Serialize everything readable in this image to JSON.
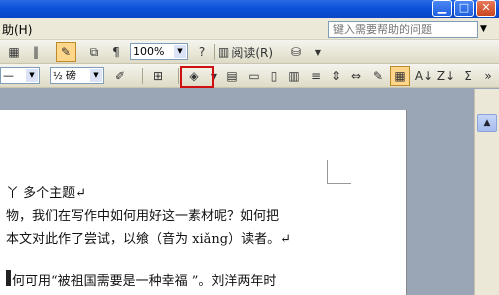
{
  "menubar": {
    "help_item": "助(H)",
    "help_search_placeholder": "键入需要帮助的问题"
  },
  "toolbar1": {
    "zoom_value": "100%",
    "read_label": "阅读(R)"
  },
  "toolbar2": {
    "font_size_value": "½ 磅",
    "line_dash": "—"
  },
  "document": {
    "line1": "丫 多个主题↵",
    "line2": "物，我们在写作中如何用好这一素材呢？如何把",
    "line3": "本文对此作了尝试，以飨（音为 xiǎng）读者。↵",
    "line4": "何可用“被祖国需要是一种幸福 ”。刘洋两年时"
  },
  "colors": {
    "titlebar": "#0b4fd8",
    "toolbar": "#ece9d8",
    "highlight_border": "#d01010",
    "workspace": "#9aa6b6"
  }
}
